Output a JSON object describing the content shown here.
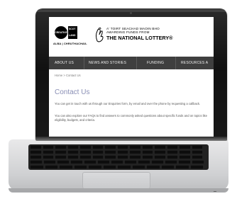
{
  "logo": {
    "circle_text": "CREATIVE",
    "square_line1": "SCOT",
    "square_line2": "LAND",
    "caption": "ALBA | CHRUTHACHAIL"
  },
  "lottery": {
    "line1": "A' TOIRT SEACHAD MAOIN BHO",
    "line2": "AWARDING FUNDS FROM",
    "line3": "THE NATIONAL LOTTERY®"
  },
  "nav": {
    "items": [
      "ABOUT US",
      "NEWS AND STORIES",
      "FUNDING",
      "RESOURCES A"
    ]
  },
  "breadcrumb": "Home > Contact Us",
  "page": {
    "title": "Contact Us",
    "paragraph1": "You can get in touch with us through our Enquiries form, by email and over the phone by requesting a callback.",
    "paragraph2": "You can also explore our FAQs to find answers to commonly asked questions about specific funds and on topics like eligibility, budgets, and criteria."
  }
}
